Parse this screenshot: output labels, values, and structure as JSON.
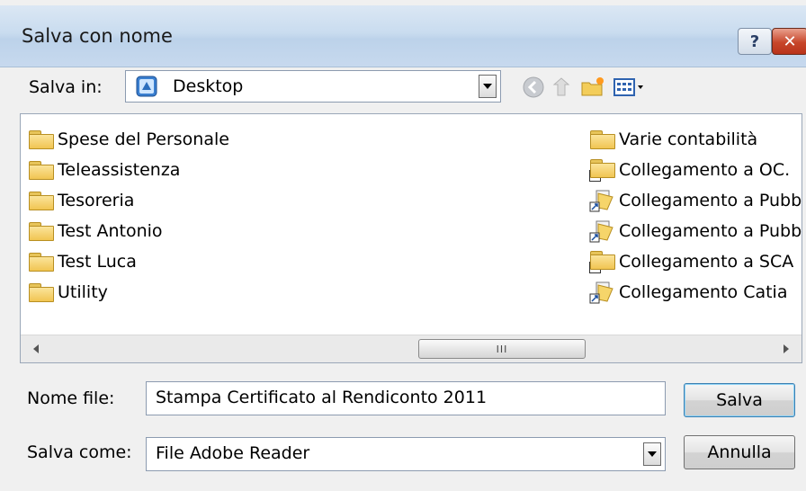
{
  "window": {
    "title": "Salva con nome"
  },
  "titlebar": {
    "help_icon": "?",
    "close_icon": "✕"
  },
  "location": {
    "label": "Salva in:",
    "value": "Desktop"
  },
  "files_left": [
    "Spese del Personale",
    "Teleassistenza",
    "Tesoreria",
    "Test Antonio",
    "Test Luca",
    "Utility"
  ],
  "files_right": [
    {
      "name": "Varie contabilità",
      "type": "folder-icon"
    },
    {
      "name": "Collegamento a OC.",
      "type": "shortcut-icon"
    },
    {
      "name": "Collegamento a Pubb",
      "type": "document-shortcut-icon"
    },
    {
      "name": "Collegamento a Pubb",
      "type": "document-shortcut-icon"
    },
    {
      "name": "Collegamento a SCA",
      "type": "shortcut-icon"
    },
    {
      "name": "Collegamento Catia",
      "type": "document-shortcut-icon"
    }
  ],
  "scrollbar": {
    "thumb_grip": "III"
  },
  "filename": {
    "label": "Nome file:",
    "value": "Stampa Certificato al Rendiconto 2011"
  },
  "filetype": {
    "label": "Salva come:",
    "value": "File Adobe Reader"
  },
  "buttons": {
    "save": "Salva",
    "cancel": "Annulla"
  }
}
